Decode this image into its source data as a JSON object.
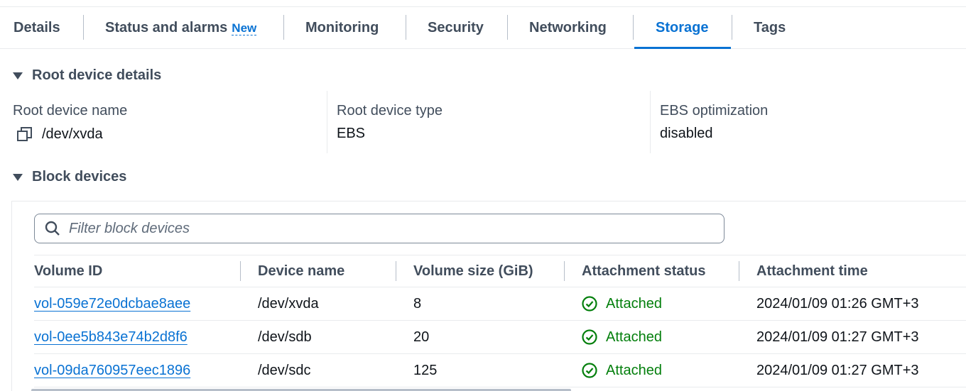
{
  "tabs": [
    {
      "label": "Details"
    },
    {
      "label": "Status and alarms",
      "badge": "New"
    },
    {
      "label": "Monitoring"
    },
    {
      "label": "Security"
    },
    {
      "label": "Networking"
    },
    {
      "label": "Storage",
      "active": true
    },
    {
      "label": "Tags"
    }
  ],
  "root_device": {
    "header": "Root device details",
    "name_label": "Root device name",
    "name_value": "/dev/xvda",
    "type_label": "Root device type",
    "type_value": "EBS",
    "ebs_label": "EBS optimization",
    "ebs_value": "disabled"
  },
  "block_devices": {
    "header": "Block devices",
    "filter_placeholder": "Filter block devices",
    "columns": [
      "Volume ID",
      "Device name",
      "Volume size (GiB)",
      "Attachment status",
      "Attachment time"
    ],
    "rows": [
      {
        "volume_id": "vol-059e72e0dcbae8aee",
        "device": "/dev/xvda",
        "size": "8",
        "status": "Attached",
        "time": "2024/01/09 01:26 GMT+3"
      },
      {
        "volume_id": "vol-0ee5b843e74b2d8f6",
        "device": "/dev/sdb",
        "size": "20",
        "status": "Attached",
        "time": "2024/01/09 01:27 GMT+3"
      },
      {
        "volume_id": "vol-09da760957eec1896",
        "device": "/dev/sdc",
        "size": "125",
        "status": "Attached",
        "time": "2024/01/09 01:27 GMT+3"
      }
    ]
  },
  "colors": {
    "accent": "#0972d3",
    "success": "#037f0c",
    "text": "#0f141a",
    "secondary_text": "#414d5c"
  },
  "icons": {
    "copy": "copy-icon",
    "search": "search-icon",
    "status_ok": "check-circle-icon",
    "caret": "caret-down-icon"
  }
}
